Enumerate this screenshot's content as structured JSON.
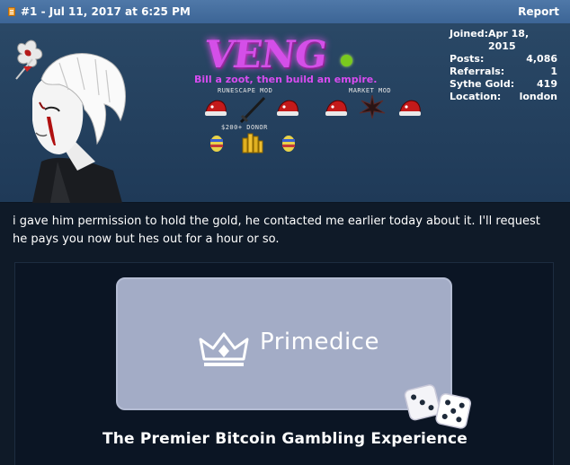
{
  "post": {
    "header": "#1 - Jul 11, 2017 at 6:25 PM",
    "report_label": "Report"
  },
  "profile": {
    "banner_title": "VENG",
    "tagline": "Bill a zoot, then build an empire.",
    "ranks": {
      "runescape_mod": "RUNESCAPE MOD",
      "market_mod": "MARKET MOD",
      "donor": "$200+ DONOR"
    },
    "online_color": "#7ac91f",
    "stats": [
      {
        "label": "Joined:",
        "value": "Apr 18, 2015"
      },
      {
        "label": "Posts:",
        "value": "4,086"
      },
      {
        "label": "Referrals:",
        "value": "1"
      },
      {
        "label": "Sythe Gold:",
        "value": "419"
      },
      {
        "label": "Location:",
        "value": "london"
      }
    ]
  },
  "message": {
    "text": "i gave him permission to hold the gold, he contacted me earlier today about it. I'll request he pays you now but hes out for a hour or so."
  },
  "ad": {
    "brand": "Primedice",
    "tagline": "The Premier Bitcoin Gambling Experience"
  },
  "colors": {
    "header_bg": "#4a73a3",
    "profile_bg": "#26435f",
    "page_bg": "#0f1a28",
    "accent_purple": "#d84cf0"
  }
}
